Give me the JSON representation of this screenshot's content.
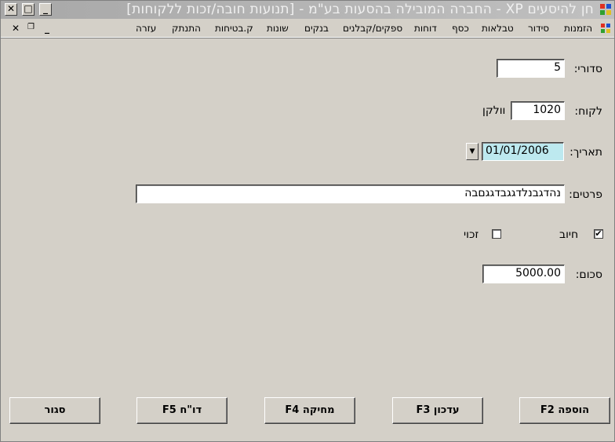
{
  "window": {
    "title": "חן להיסעים XP - החברה המובילה בהסעות בע\"מ - [תנועות חובה/זכות ללקוחות]",
    "controls": {
      "minimize": "_",
      "maximize": "□",
      "close": "✕"
    }
  },
  "menubar": {
    "items": [
      "הזמנות",
      "סידור",
      "טבלאות",
      "כסף",
      "דוחות",
      "ספקים/קבלנים",
      "בנקים",
      "שונות",
      "ק.בטיחות",
      "התנתק",
      "עזרה"
    ],
    "mdi": {
      "minimize": "_",
      "restore": "🗗",
      "close": "✕"
    }
  },
  "form": {
    "serial": {
      "label": "סדורי:",
      "value": "5"
    },
    "customer": {
      "label": "לקוח:",
      "code": "1020",
      "name": "וולקן"
    },
    "date": {
      "label": "תאריך:",
      "value": "01/01/2006",
      "dropdown": "▼"
    },
    "details": {
      "label": "פרטים:",
      "value": "נהדגבנלדגגבדגגםבה"
    },
    "debit": {
      "label": "חיוב",
      "checked": "✔"
    },
    "credit": {
      "label": "זכוי",
      "checked": ""
    },
    "amount": {
      "label": "סכום:",
      "value": "5000.00"
    }
  },
  "buttons": {
    "add": "הוספה F2",
    "edit": "עדכון F3",
    "delete": "מחיקה F4",
    "report": "דו\"ח F5",
    "close": "סגור"
  },
  "colors": {
    "date_bg": "#bde9ef",
    "window_bg": "#d4d0c8"
  }
}
